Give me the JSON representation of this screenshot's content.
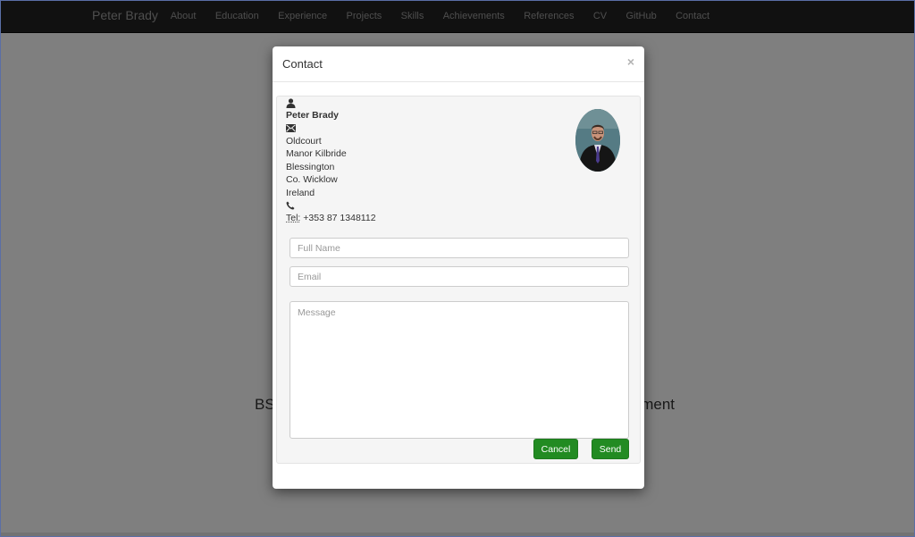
{
  "navbar": {
    "brand": "Peter Brady",
    "items": [
      {
        "label": "About"
      },
      {
        "label": "Education"
      },
      {
        "label": "Experience"
      },
      {
        "label": "Projects"
      },
      {
        "label": "Skills"
      },
      {
        "label": "Achievements"
      },
      {
        "label": "References"
      },
      {
        "label": "CV"
      },
      {
        "label": "GitHub"
      },
      {
        "label": "Contact"
      }
    ]
  },
  "background": {
    "heading_left": "BS",
    "heading_right": "ment"
  },
  "modal": {
    "title": "Contact",
    "close": "×",
    "contact": {
      "user_icon": "user-icon",
      "name": "Peter Brady",
      "mail_icon": "envelope-icon",
      "address": [
        "Oldcourt",
        "Manor Kilbride",
        "Blessington",
        "Co. Wicklow",
        "Ireland"
      ],
      "phone_icon": "phone-icon",
      "tel_label": "Tel:",
      "tel_number": "+353 87 1348112"
    },
    "form": {
      "name_placeholder": "Full Name",
      "email_placeholder": "Email",
      "message_placeholder": "Message",
      "cancel_label": "Cancel",
      "send_label": "Send"
    },
    "colors": {
      "button": "#228b22",
      "overlay": "rgba(0,0,0,0.5)"
    }
  }
}
